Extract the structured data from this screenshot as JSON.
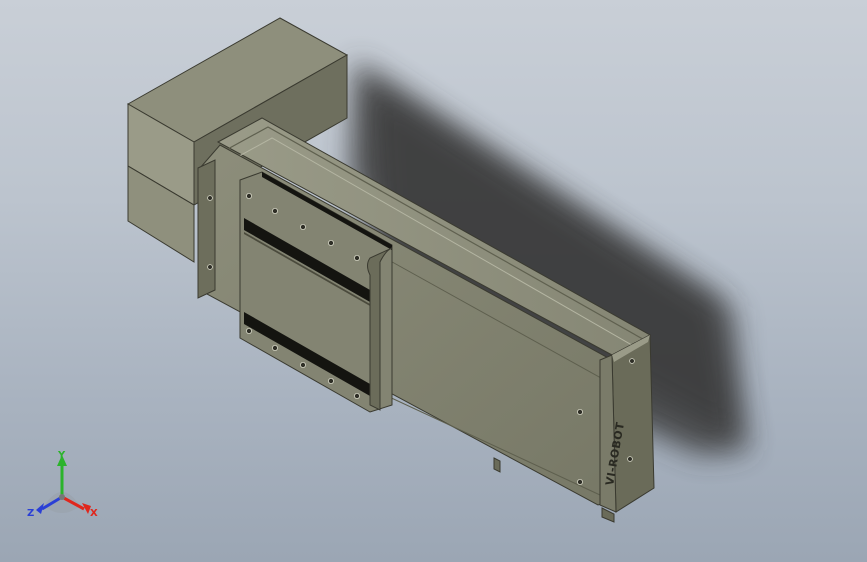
{
  "model": {
    "brand_text": "VI-ROBOT"
  },
  "triad": {
    "x_label": "X",
    "y_label": "Y",
    "z_label": "Z",
    "x_color": "#e0261c",
    "y_color": "#2bb32b",
    "z_color": "#2a3fd6"
  },
  "colors": {
    "background_top": "#c9cfd7",
    "background_bottom": "#9ba6b4",
    "body_light": "#8a8b78",
    "body_mid": "#7b7c6a",
    "body_dark": "#5f604f",
    "slot_black": "#141410",
    "shadow": "#3e3e3e"
  }
}
